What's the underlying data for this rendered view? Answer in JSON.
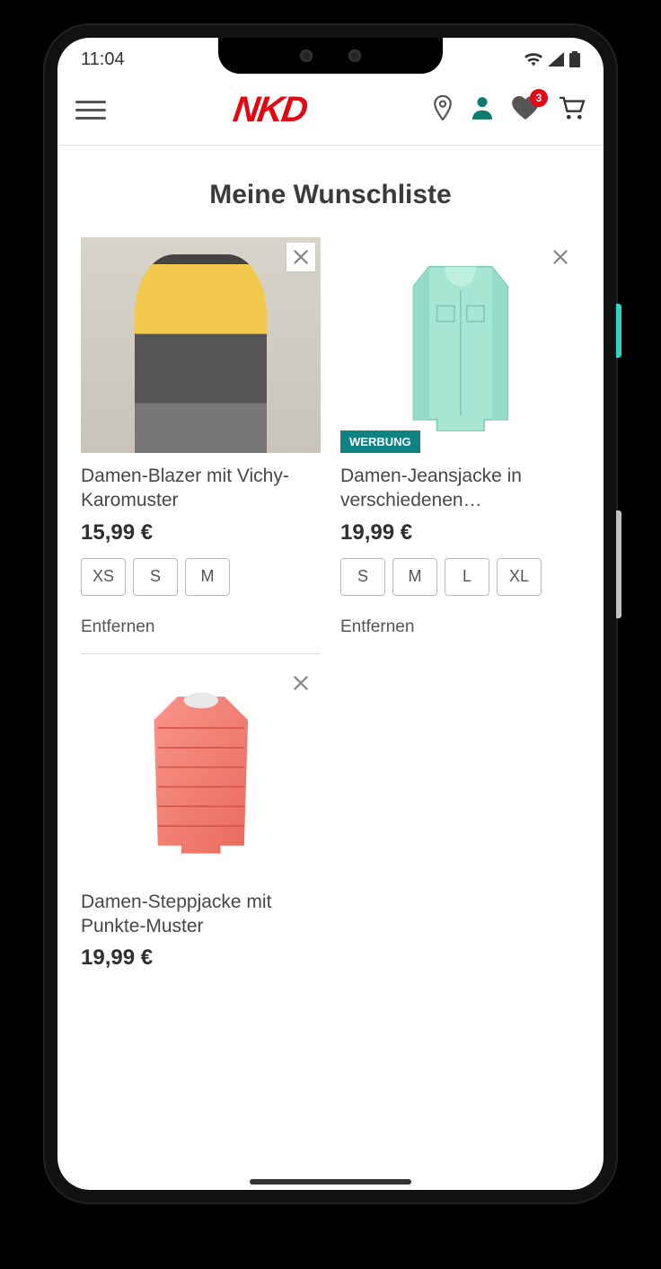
{
  "status": {
    "time": "11:04"
  },
  "header": {
    "logo_text": "NKD",
    "wishlist_badge": "3"
  },
  "page": {
    "title": "Meine Wunschliste",
    "remove_label": "Entfernen"
  },
  "products": [
    {
      "title": "Damen-Blazer mit Vichy-Karomuster",
      "price": "15,99 €",
      "sizes": [
        "XS",
        "S",
        "M"
      ],
      "tag": null,
      "image_kind": "model"
    },
    {
      "title": "Damen-Jeansjacke in verschiedenen…",
      "price": "19,99 €",
      "sizes": [
        "S",
        "M",
        "L",
        "XL"
      ],
      "tag": "WERBUNG",
      "image_kind": "mint-jacket"
    },
    {
      "title": "Damen-Steppjacke mit Punkte-Muster",
      "price": "19,99 €",
      "sizes": [],
      "tag": null,
      "image_kind": "coral-puffer"
    }
  ]
}
